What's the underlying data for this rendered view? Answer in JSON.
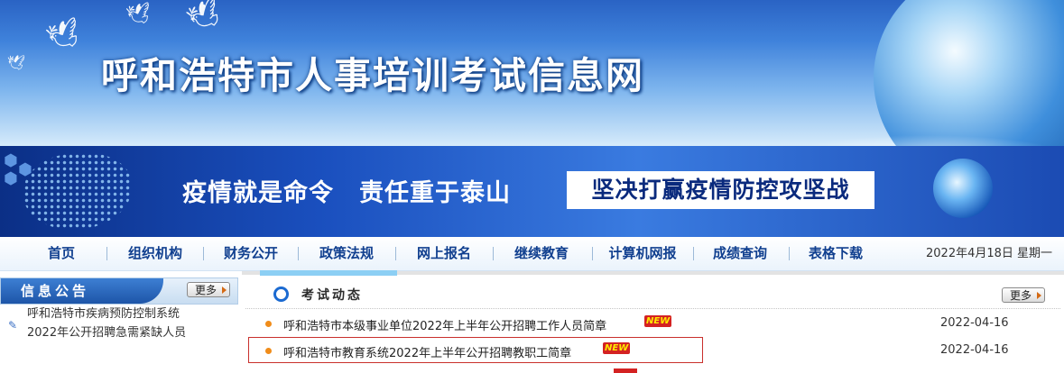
{
  "header": {
    "site_title": "呼和浩特市人事培训考试信息网"
  },
  "banner": {
    "slogan": "疫情就是命令　责任重于泰山",
    "slogan_highlight": "坚决打赢疫情防控攻坚战"
  },
  "nav": {
    "items": [
      "首页",
      "组织机构",
      "财务公开",
      "政策法规",
      "网上报名",
      "继续教育",
      "计算机网报",
      "成绩查询",
      "表格下载"
    ],
    "date": "2022年4月18日 星期一"
  },
  "sidebar": {
    "title": "信息公告",
    "more_label": "更多",
    "lines": [
      "呼和浩特市疾病预防控制系统",
      "2022年公开招聘急需紧缺人员"
    ]
  },
  "main": {
    "section_title": "考试动态",
    "more_label": "更多",
    "new_badge": "NEW",
    "rows": [
      {
        "title": "呼和浩特市本级事业单位2022年上半年公开招聘工作人员简章",
        "date": "2022-04-16"
      },
      {
        "title": "呼和浩特市教育系统2022年上半年公开招聘教职工简章",
        "date": "2022-04-16"
      }
    ]
  },
  "colors": {
    "nav_text": "#103f8f",
    "accent_blue": "#1d55a8",
    "bullet_orange": "#f08c1a",
    "highlight_border": "#c9302c",
    "new_badge_bg": "#d42222"
  }
}
